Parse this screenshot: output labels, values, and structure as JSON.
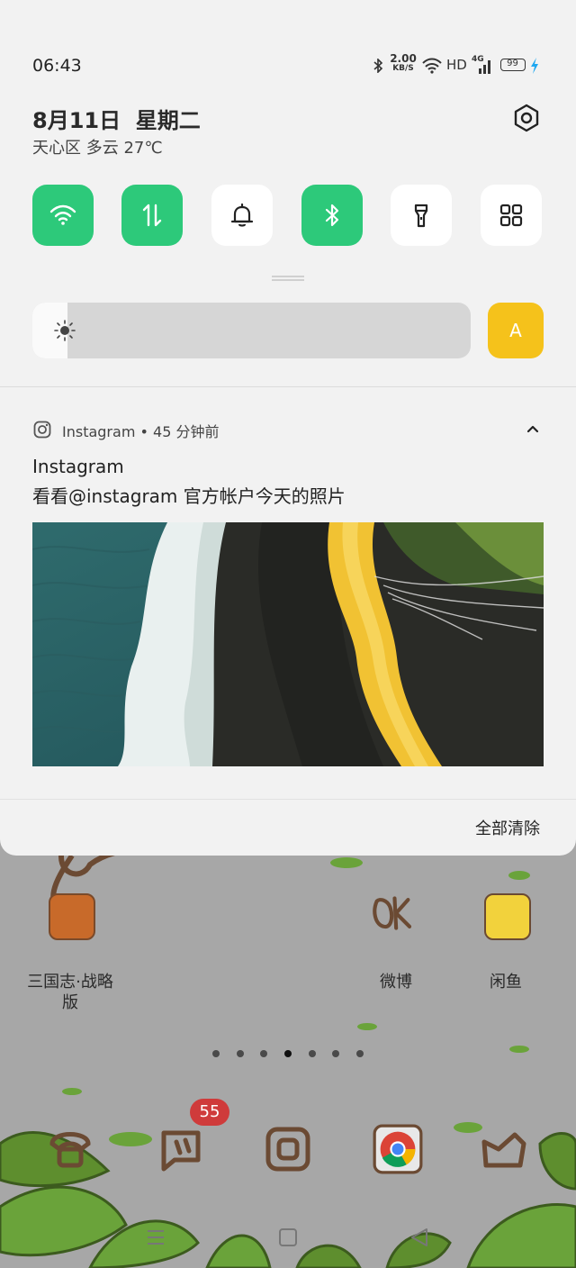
{
  "status_bar": {
    "time": "06:43",
    "speed_value": "2.00",
    "speed_unit": "KB/S",
    "hd": "HD",
    "network": "4G",
    "battery": "99"
  },
  "header": {
    "date": "8月11日  星期二",
    "weather": "天心区 多云 27℃"
  },
  "quick_tiles": [
    {
      "icon": "wifi-icon",
      "on": true
    },
    {
      "icon": "mobile-data-icon",
      "on": true
    },
    {
      "icon": "bell-icon",
      "on": false
    },
    {
      "icon": "bluetooth-icon",
      "on": true
    },
    {
      "icon": "flashlight-icon",
      "on": false
    },
    {
      "icon": "apps-grid-icon",
      "on": false
    }
  ],
  "brightness": {
    "level_fraction": 0.08,
    "auto_label": "A"
  },
  "notification": {
    "app_line": "Instagram • 45 分钟前",
    "title": "Instagram",
    "text": "看看@instagram 官方帐户今天的照片"
  },
  "clear_all": "全部清除",
  "home": {
    "apps": [
      {
        "label": "三国志·战略\n版"
      },
      {
        "label": "微博"
      },
      {
        "label": "闲鱼"
      }
    ],
    "badge": "55",
    "page_count": 7,
    "active_page": 4
  },
  "colors": {
    "accent_green": "#2dc97a",
    "auto_yellow": "#f5c21b",
    "badge_red": "#cf3b3b"
  }
}
